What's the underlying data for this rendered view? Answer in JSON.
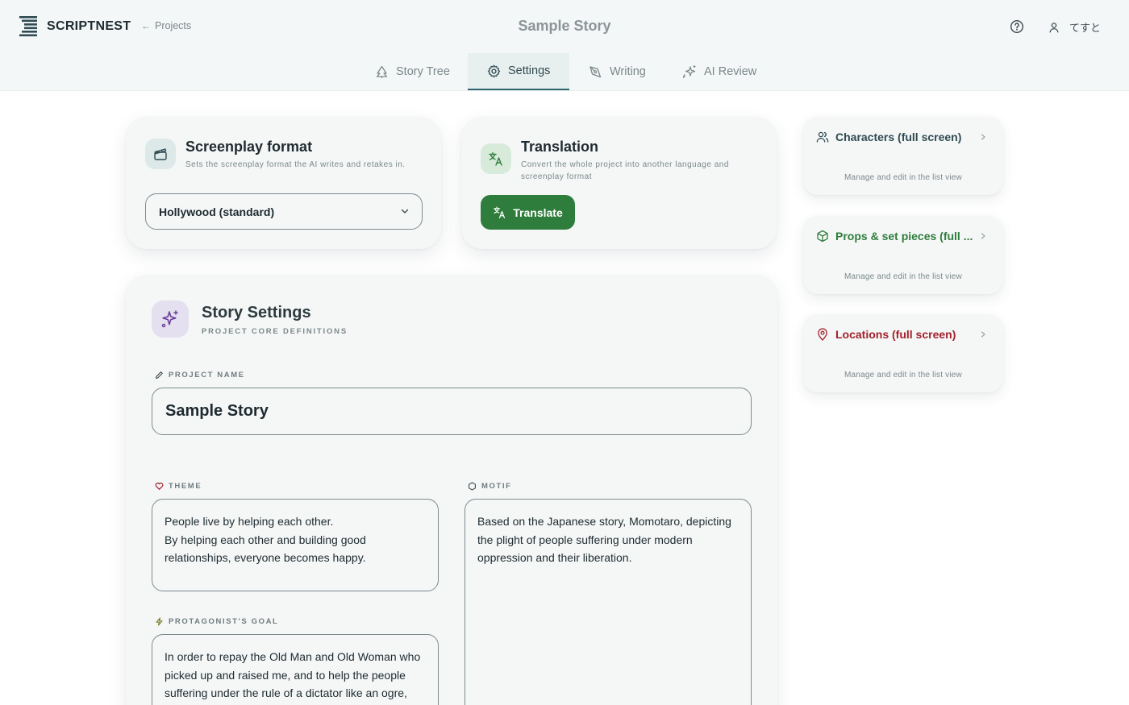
{
  "header": {
    "brand": "SCRIPTNEST",
    "back_label": "Projects",
    "title": "Sample Story",
    "user_name": "てすと"
  },
  "tabs": [
    {
      "label": "Story Tree",
      "icon": "tree-icon",
      "active": false
    },
    {
      "label": "Settings",
      "icon": "gear-icon",
      "active": true
    },
    {
      "label": "Writing",
      "icon": "pen-icon",
      "active": false
    },
    {
      "label": "AI Review",
      "icon": "sparkles-icon",
      "active": false
    }
  ],
  "format_card": {
    "title": "Screenplay format",
    "subtitle": "Sets the screenplay format the AI writes and retakes in.",
    "selected": "Hollywood (standard)"
  },
  "translation_card": {
    "title": "Translation",
    "subtitle": "Convert the whole project into another language and screenplay format",
    "button_label": "Translate"
  },
  "story_settings": {
    "title": "Story Settings",
    "subtitle": "PROJECT CORE DEFINITIONS",
    "project_name_label": "PROJECT NAME",
    "project_name": "Sample Story",
    "theme_label": "THEME",
    "theme": "People live by helping each other.\nBy helping each other and building good relationships, everyone becomes happy.",
    "motif_label": "MOTIF",
    "motif": "Based on the Japanese story, Momotaro, depicting the plight of people suffering under modern oppression and their liberation.",
    "goal_label": "PROTAGONIST'S GOAL",
    "goal": "In order to repay the Old Man and Old Woman who picked up and raised me, and to help the people suffering under the rule of a dictator like an ogre, fight and defeat the ogre and liberate the land."
  },
  "side_cards": [
    {
      "title": "Characters (full screen)",
      "subtitle": "Manage and edit in the list view",
      "color": "#2f4a52",
      "icon": "users-icon"
    },
    {
      "title": "Props & set pieces (full ...",
      "subtitle": "Manage and edit in the list view",
      "color": "#2e7d3c",
      "icon": "cube-icon"
    },
    {
      "title": "Locations (full screen)",
      "subtitle": "Manage and edit in the list view",
      "color": "#a3202a",
      "icon": "map-pin-icon"
    }
  ],
  "colors": {
    "accent": "#2e7d3c",
    "active_tab": "#2f6670",
    "locations": "#a3202a",
    "story_icon_bg": "#e5e0ef"
  }
}
